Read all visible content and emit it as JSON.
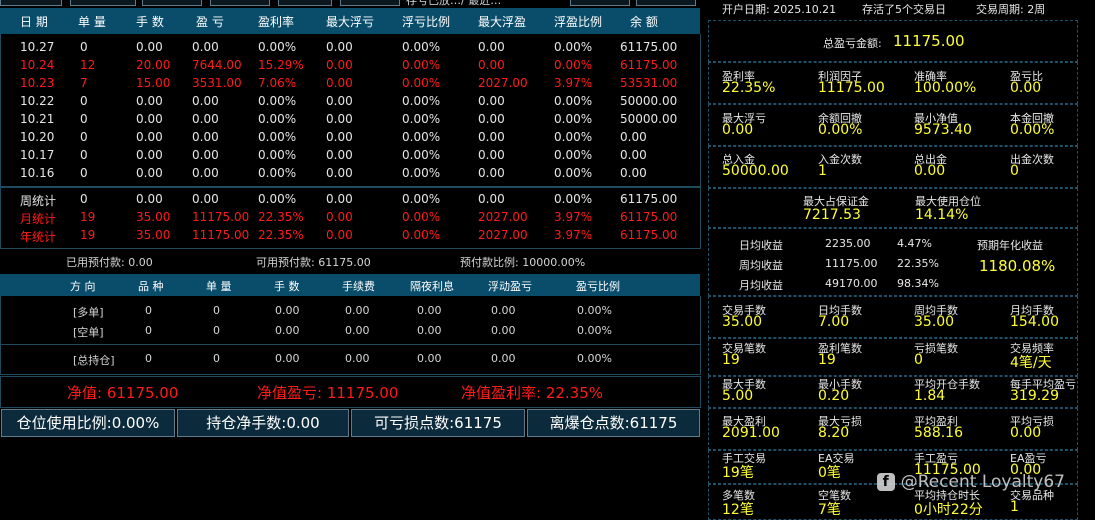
{
  "top": {
    "partial_text": "存亏已放…/  最近…"
  },
  "table": {
    "headers": [
      "日 期",
      "单 量",
      "手 数",
      "盈 亏",
      "盈利率",
      "最大浮亏",
      "浮亏比例",
      "最大浮盈",
      "浮盈比例",
      "余 额"
    ],
    "rows": [
      {
        "c": [
          "10.27",
          "0",
          "0.00",
          "0.00",
          "0.00%",
          "0.00",
          "0.00%",
          "0.00",
          "0.00%",
          "61175.00"
        ],
        "color": "white"
      },
      {
        "c": [
          "10.24",
          "12",
          "20.00",
          "7644.00",
          "15.29%",
          "0.00",
          "0.00%",
          "0.00",
          "0.00%",
          "61175.00"
        ],
        "color": "red"
      },
      {
        "c": [
          "10.23",
          "7",
          "15.00",
          "3531.00",
          "7.06%",
          "0.00",
          "0.00%",
          "2027.00",
          "3.97%",
          "53531.00"
        ],
        "color": "red"
      },
      {
        "c": [
          "10.22",
          "0",
          "0.00",
          "0.00",
          "0.00%",
          "0.00",
          "0.00%",
          "0.00",
          "0.00%",
          "50000.00"
        ],
        "color": "white"
      },
      {
        "c": [
          "10.21",
          "0",
          "0.00",
          "0.00",
          "0.00%",
          "0.00",
          "0.00%",
          "0.00",
          "0.00%",
          "50000.00"
        ],
        "color": "white"
      },
      {
        "c": [
          "10.20",
          "0",
          "0.00",
          "0.00",
          "0.00%",
          "0.00",
          "0.00%",
          "0.00",
          "0.00%",
          "0.00"
        ],
        "color": "white"
      },
      {
        "c": [
          "10.17",
          "0",
          "0.00",
          "0.00",
          "0.00%",
          "0.00",
          "0.00%",
          "0.00",
          "0.00%",
          "0.00"
        ],
        "color": "white"
      },
      {
        "c": [
          "10.16",
          "0",
          "0.00",
          "0.00",
          "0.00%",
          "0.00",
          "0.00%",
          "0.00",
          "0.00%",
          "0.00"
        ],
        "color": "white"
      }
    ],
    "summary": [
      {
        "c": [
          "周统计",
          "0",
          "0.00",
          "0.00",
          "0.00%",
          "0.00",
          "0.00%",
          "0.00",
          "0.00%",
          "61175.00"
        ],
        "color": "white"
      },
      {
        "c": [
          "月统计",
          "19",
          "35.00",
          "11175.00",
          "22.35%",
          "0.00",
          "0.00%",
          "2027.00",
          "3.97%",
          "61175.00"
        ],
        "color": "red"
      },
      {
        "c": [
          "年统计",
          "19",
          "35.00",
          "11175.00",
          "22.35%",
          "0.00",
          "0.00%",
          "2027.00",
          "3.97%",
          "61175.00"
        ],
        "color": "red"
      }
    ]
  },
  "advance": {
    "used": "已用预付款:  0.00",
    "avail": "可用预付款:  61175.00",
    "ratio": "预付款比例:  10000.00%"
  },
  "positions": {
    "headers": [
      "方 向",
      "品 种",
      "单 量",
      "手 数",
      "手续费",
      "隔夜利息",
      "浮动盈亏",
      "盈亏比例"
    ],
    "rows": [
      [
        "[多单]",
        "0",
        "0",
        "0.00",
        "0.00",
        "0.00",
        "0.00",
        "0.00%"
      ],
      [
        "[空单]",
        "0",
        "0",
        "0.00",
        "0.00",
        "0.00",
        "0.00",
        "0.00%"
      ],
      [
        "[总持仓]",
        "0",
        "0",
        "0.00",
        "0.00",
        "0.00",
        "0.00",
        "0.00%"
      ]
    ]
  },
  "net": {
    "value": "净值:  61175.00",
    "pnl": "净值盈亏:  11175.00",
    "rate": "净值盈利率:  22.35%"
  },
  "buttons": [
    "仓位使用比例:0.00%",
    "持仓净手数:0.00",
    "可亏损点数:61175",
    "离爆仓点数:61175"
  ],
  "right": {
    "open_date": "开户日期:    2025.10.21",
    "alive": "存活了5个交易日",
    "period": "交易周期:  2周",
    "total_label": "总盈亏金额:",
    "total_value": "11175.00",
    "grid1": [
      {
        "l": "盈利率",
        "v": "22.35%"
      },
      {
        "l": "利润因子",
        "v": "11175.00"
      },
      {
        "l": "准确率",
        "v": "100.00%"
      },
      {
        "l": "盈亏比",
        "v": "0.00"
      },
      {
        "l": "最大浮亏",
        "v": "0.00"
      },
      {
        "l": "余额回撤",
        "v": "0.00%"
      },
      {
        "l": "最小净值",
        "v": "9573.40"
      },
      {
        "l": "本金回撤",
        "v": "0.00%"
      },
      {
        "l": "总入金",
        "v": "50000.00"
      },
      {
        "l": "入金次数",
        "v": "1"
      },
      {
        "l": "总出金",
        "v": "0.00"
      },
      {
        "l": "出金次数",
        "v": "0"
      }
    ],
    "margin": [
      {
        "l": "最大占保证金",
        "v": "7217.53"
      },
      {
        "l": "最大使用仓位",
        "v": "14.14%"
      }
    ],
    "returns": [
      {
        "l": "日均收益",
        "a": "2235.00",
        "p": "4.47%"
      },
      {
        "l": "周均收益",
        "a": "11175.00",
        "p": "22.35%"
      },
      {
        "l": "月均收益",
        "a": "49170.00",
        "p": "98.34%"
      }
    ],
    "annual_label": "预期年化收益",
    "annual_value": "1180.08%",
    "grid2": [
      {
        "l": "交易手数",
        "v": "35.00"
      },
      {
        "l": "日均手数",
        "v": "7.00"
      },
      {
        "l": "周均手数",
        "v": "35.00"
      },
      {
        "l": "月均手数",
        "v": "154.00"
      },
      {
        "l": "交易笔数",
        "v": "19"
      },
      {
        "l": "盈利笔数",
        "v": "19"
      },
      {
        "l": "亏损笔数",
        "v": "0"
      },
      {
        "l": "交易频率",
        "v": "4笔/天"
      },
      {
        "l": "最大手数",
        "v": "5.00"
      },
      {
        "l": "最小手数",
        "v": "0.20"
      },
      {
        "l": "平均开仓手数",
        "v": "1.84"
      },
      {
        "l": "每手平均盈亏",
        "v": "319.29"
      },
      {
        "l": "最大盈利",
        "v": "2091.00"
      },
      {
        "l": "最大亏损",
        "v": "8.20"
      },
      {
        "l": "平均盈利",
        "v": "588.16"
      },
      {
        "l": "平均亏损",
        "v": "0.00"
      },
      {
        "l": "手工交易",
        "v": "19笔"
      },
      {
        "l": "EA交易",
        "v": "0笔"
      },
      {
        "l": "手工盈亏",
        "v": "11175.00"
      },
      {
        "l": "EA盈亏",
        "v": "0.00"
      },
      {
        "l": "多笔数",
        "v": "12笔"
      },
      {
        "l": "空笔数",
        "v": "7笔"
      },
      {
        "l": "平均持仓时长",
        "v": "0小时22分"
      },
      {
        "l": "交易品种",
        "v": "1"
      }
    ]
  },
  "watermark": "@Recent Loyalty67"
}
